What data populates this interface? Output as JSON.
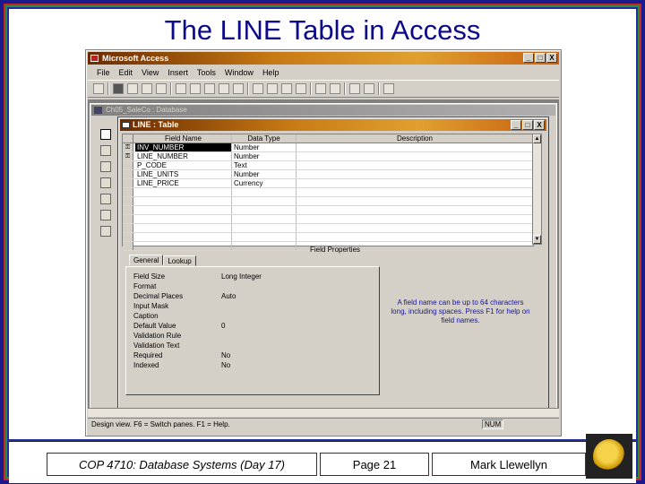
{
  "slide": {
    "title": "The LINE Table in Access",
    "footer": {
      "course": "COP 4710: Database Systems (Day 17)",
      "page": "Page 21",
      "author": "Mark Llewellyn"
    }
  },
  "app": {
    "title": "Microsoft Access",
    "menu": [
      "File",
      "Edit",
      "View",
      "Insert",
      "Tools",
      "Window",
      "Help"
    ],
    "window_buttons": [
      "_",
      "□",
      "X"
    ]
  },
  "db_window": {
    "title": "Ch05_SaleCo : Database"
  },
  "table_window": {
    "title": "LINE : Table",
    "columns": [
      "Field Name",
      "Data Type",
      "Description"
    ],
    "rows": [
      {
        "key": "⚿",
        "field": "INV_NUMBER",
        "type": "Number",
        "selected": true
      },
      {
        "key": "⚿",
        "field": "LINE_NUMBER",
        "type": "Number",
        "selected": false
      },
      {
        "key": "",
        "field": "P_CODE",
        "type": "Text",
        "selected": false
      },
      {
        "key": "",
        "field": "LINE_UNITS",
        "type": "Number",
        "selected": false
      },
      {
        "key": "",
        "field": "LINE_PRICE",
        "type": "Currency",
        "selected": false
      }
    ],
    "field_properties_label": "Field Properties",
    "tabs": [
      "General",
      "Lookup"
    ],
    "properties": [
      {
        "label": "Field Size",
        "value": "Long Integer"
      },
      {
        "label": "Format",
        "value": ""
      },
      {
        "label": "Decimal Places",
        "value": "Auto"
      },
      {
        "label": "Input Mask",
        "value": ""
      },
      {
        "label": "Caption",
        "value": ""
      },
      {
        "label": "Default Value",
        "value": "0"
      },
      {
        "label": "Validation Rule",
        "value": ""
      },
      {
        "label": "Validation Text",
        "value": ""
      },
      {
        "label": "Required",
        "value": "No"
      },
      {
        "label": "Indexed",
        "value": "No"
      }
    ],
    "help_text": "A field name can be up to 64 characters long, including spaces. Press F1 for help on field names."
  },
  "statusbar": {
    "message": "Design view.  F6 = Switch panes.  F1 = Help.",
    "num": "NUM"
  }
}
